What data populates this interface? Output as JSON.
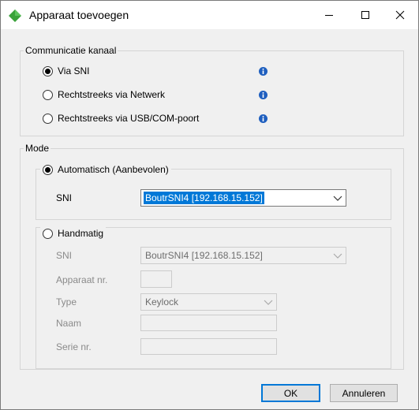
{
  "window": {
    "title": "Apparaat toevoegen"
  },
  "communicatie": {
    "legend": "Communicatie kanaal",
    "options": [
      {
        "label": "Via SNI",
        "checked": true
      },
      {
        "label": "Rechtstreeks via Netwerk",
        "checked": false
      },
      {
        "label": "Rechtstreeks via USB/COM-poort",
        "checked": false
      }
    ]
  },
  "mode": {
    "legend": "Mode",
    "automatisch": {
      "label": "Automatisch (Aanbevolen)",
      "checked": true,
      "sni_label": "SNI",
      "sni_value": "BoutrSNI4 [192.168.15.152]"
    },
    "handmatig": {
      "label": "Handmatig",
      "checked": false,
      "sni_label": "SNI",
      "sni_value": "BoutrSNI4 [192.168.15.152]",
      "apparaat_label": "Apparaat nr.",
      "apparaat_value": "",
      "type_label": "Type",
      "type_value": "Keylock",
      "naam_label": "Naam",
      "naam_value": "",
      "serie_label": "Serie nr.",
      "serie_value": ""
    }
  },
  "buttons": {
    "ok": "OK",
    "annuleren": "Annuleren"
  },
  "colors": {
    "accent": "#0078d7",
    "logo": "#3aa23a",
    "info": "#1f5fbf"
  }
}
